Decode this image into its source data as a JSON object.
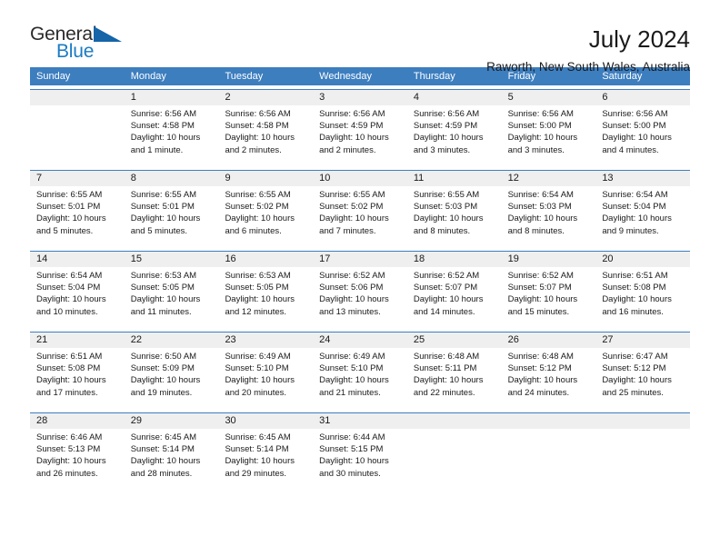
{
  "brand": {
    "name_part1": "General",
    "name_part2": "Blue",
    "accent_color": "#1a7bc4",
    "triangle_color": "#1565a8",
    "triangle_icon": "triangle-icon"
  },
  "header": {
    "title": "July 2024",
    "subtitle": "Raworth, New South Wales, Australia"
  },
  "calendar": {
    "header_bg": "#3d7ebf",
    "daynum_bg": "#efefef",
    "weekdays": [
      "Sunday",
      "Monday",
      "Tuesday",
      "Wednesday",
      "Thursday",
      "Friday",
      "Saturday"
    ],
    "weeks": [
      [
        {
          "day": "",
          "sunrise": "",
          "sunset": "",
          "daylight": "",
          "empty": true
        },
        {
          "day": "1",
          "sunrise": "Sunrise: 6:56 AM",
          "sunset": "Sunset: 4:58 PM",
          "daylight": "Daylight: 10 hours and 1 minute."
        },
        {
          "day": "2",
          "sunrise": "Sunrise: 6:56 AM",
          "sunset": "Sunset: 4:58 PM",
          "daylight": "Daylight: 10 hours and 2 minutes."
        },
        {
          "day": "3",
          "sunrise": "Sunrise: 6:56 AM",
          "sunset": "Sunset: 4:59 PM",
          "daylight": "Daylight: 10 hours and 2 minutes."
        },
        {
          "day": "4",
          "sunrise": "Sunrise: 6:56 AM",
          "sunset": "Sunset: 4:59 PM",
          "daylight": "Daylight: 10 hours and 3 minutes."
        },
        {
          "day": "5",
          "sunrise": "Sunrise: 6:56 AM",
          "sunset": "Sunset: 5:00 PM",
          "daylight": "Daylight: 10 hours and 3 minutes."
        },
        {
          "day": "6",
          "sunrise": "Sunrise: 6:56 AM",
          "sunset": "Sunset: 5:00 PM",
          "daylight": "Daylight: 10 hours and 4 minutes."
        }
      ],
      [
        {
          "day": "7",
          "sunrise": "Sunrise: 6:55 AM",
          "sunset": "Sunset: 5:01 PM",
          "daylight": "Daylight: 10 hours and 5 minutes."
        },
        {
          "day": "8",
          "sunrise": "Sunrise: 6:55 AM",
          "sunset": "Sunset: 5:01 PM",
          "daylight": "Daylight: 10 hours and 5 minutes."
        },
        {
          "day": "9",
          "sunrise": "Sunrise: 6:55 AM",
          "sunset": "Sunset: 5:02 PM",
          "daylight": "Daylight: 10 hours and 6 minutes."
        },
        {
          "day": "10",
          "sunrise": "Sunrise: 6:55 AM",
          "sunset": "Sunset: 5:02 PM",
          "daylight": "Daylight: 10 hours and 7 minutes."
        },
        {
          "day": "11",
          "sunrise": "Sunrise: 6:55 AM",
          "sunset": "Sunset: 5:03 PM",
          "daylight": "Daylight: 10 hours and 8 minutes."
        },
        {
          "day": "12",
          "sunrise": "Sunrise: 6:54 AM",
          "sunset": "Sunset: 5:03 PM",
          "daylight": "Daylight: 10 hours and 8 minutes."
        },
        {
          "day": "13",
          "sunrise": "Sunrise: 6:54 AM",
          "sunset": "Sunset: 5:04 PM",
          "daylight": "Daylight: 10 hours and 9 minutes."
        }
      ],
      [
        {
          "day": "14",
          "sunrise": "Sunrise: 6:54 AM",
          "sunset": "Sunset: 5:04 PM",
          "daylight": "Daylight: 10 hours and 10 minutes."
        },
        {
          "day": "15",
          "sunrise": "Sunrise: 6:53 AM",
          "sunset": "Sunset: 5:05 PM",
          "daylight": "Daylight: 10 hours and 11 minutes."
        },
        {
          "day": "16",
          "sunrise": "Sunrise: 6:53 AM",
          "sunset": "Sunset: 5:05 PM",
          "daylight": "Daylight: 10 hours and 12 minutes."
        },
        {
          "day": "17",
          "sunrise": "Sunrise: 6:52 AM",
          "sunset": "Sunset: 5:06 PM",
          "daylight": "Daylight: 10 hours and 13 minutes."
        },
        {
          "day": "18",
          "sunrise": "Sunrise: 6:52 AM",
          "sunset": "Sunset: 5:07 PM",
          "daylight": "Daylight: 10 hours and 14 minutes."
        },
        {
          "day": "19",
          "sunrise": "Sunrise: 6:52 AM",
          "sunset": "Sunset: 5:07 PM",
          "daylight": "Daylight: 10 hours and 15 minutes."
        },
        {
          "day": "20",
          "sunrise": "Sunrise: 6:51 AM",
          "sunset": "Sunset: 5:08 PM",
          "daylight": "Daylight: 10 hours and 16 minutes."
        }
      ],
      [
        {
          "day": "21",
          "sunrise": "Sunrise: 6:51 AM",
          "sunset": "Sunset: 5:08 PM",
          "daylight": "Daylight: 10 hours and 17 minutes."
        },
        {
          "day": "22",
          "sunrise": "Sunrise: 6:50 AM",
          "sunset": "Sunset: 5:09 PM",
          "daylight": "Daylight: 10 hours and 19 minutes."
        },
        {
          "day": "23",
          "sunrise": "Sunrise: 6:49 AM",
          "sunset": "Sunset: 5:10 PM",
          "daylight": "Daylight: 10 hours and 20 minutes."
        },
        {
          "day": "24",
          "sunrise": "Sunrise: 6:49 AM",
          "sunset": "Sunset: 5:10 PM",
          "daylight": "Daylight: 10 hours and 21 minutes."
        },
        {
          "day": "25",
          "sunrise": "Sunrise: 6:48 AM",
          "sunset": "Sunset: 5:11 PM",
          "daylight": "Daylight: 10 hours and 22 minutes."
        },
        {
          "day": "26",
          "sunrise": "Sunrise: 6:48 AM",
          "sunset": "Sunset: 5:12 PM",
          "daylight": "Daylight: 10 hours and 24 minutes."
        },
        {
          "day": "27",
          "sunrise": "Sunrise: 6:47 AM",
          "sunset": "Sunset: 5:12 PM",
          "daylight": "Daylight: 10 hours and 25 minutes."
        }
      ],
      [
        {
          "day": "28",
          "sunrise": "Sunrise: 6:46 AM",
          "sunset": "Sunset: 5:13 PM",
          "daylight": "Daylight: 10 hours and 26 minutes."
        },
        {
          "day": "29",
          "sunrise": "Sunrise: 6:45 AM",
          "sunset": "Sunset: 5:14 PM",
          "daylight": "Daylight: 10 hours and 28 minutes."
        },
        {
          "day": "30",
          "sunrise": "Sunrise: 6:45 AM",
          "sunset": "Sunset: 5:14 PM",
          "daylight": "Daylight: 10 hours and 29 minutes."
        },
        {
          "day": "31",
          "sunrise": "Sunrise: 6:44 AM",
          "sunset": "Sunset: 5:15 PM",
          "daylight": "Daylight: 10 hours and 30 minutes."
        },
        {
          "day": "",
          "sunrise": "",
          "sunset": "",
          "daylight": "",
          "empty": true
        },
        {
          "day": "",
          "sunrise": "",
          "sunset": "",
          "daylight": "",
          "empty": true
        },
        {
          "day": "",
          "sunrise": "",
          "sunset": "",
          "daylight": "",
          "empty": true
        }
      ]
    ]
  }
}
